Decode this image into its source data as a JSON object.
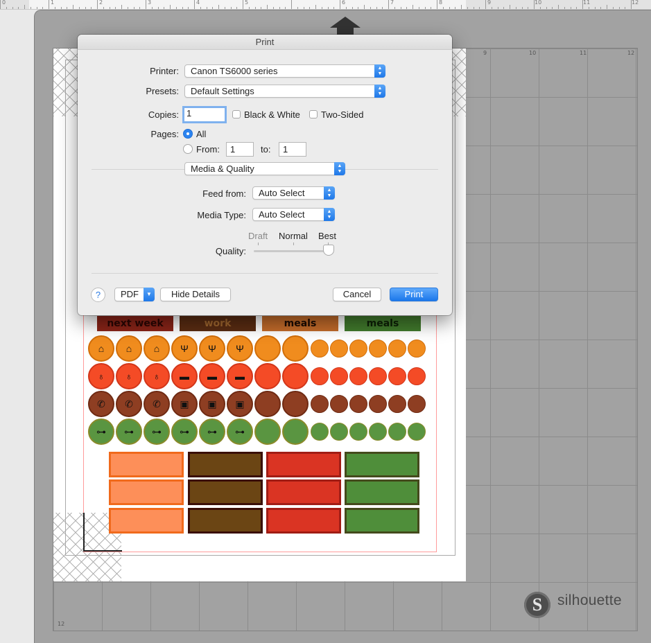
{
  "ruler": {
    "numbers": [
      "0",
      "1",
      "2",
      "3",
      "4",
      "5",
      "6",
      "7",
      "8",
      "9",
      "10",
      "11",
      "12"
    ]
  },
  "mat": {
    "grid_numbers": [
      "9",
      "10",
      "11",
      "12"
    ],
    "bottom_number": "12"
  },
  "stickers": {
    "labels": [
      "next week",
      "work",
      "meals",
      "meals"
    ],
    "colors": {
      "orange": "#f08c1e",
      "red": "#f44b26",
      "brown": "#8e3e22",
      "green": "#5a9541",
      "dark_red": "#8a2418",
      "dark_brown": "#5a2c12",
      "rect_orange": "#fd8f59",
      "rect_brown": "#6b4514",
      "rect_red": "#da3423",
      "rect_green": "#4f8e3a"
    },
    "icon_names": [
      "house-icon",
      "utensils-icon",
      "stethoscope-icon",
      "car-icon",
      "phone-icon",
      "gift-icon",
      "dumbbell-icon"
    ]
  },
  "logo": {
    "text": "silhouette",
    "mark": "S"
  },
  "dialog": {
    "title": "Print",
    "printer": {
      "label": "Printer:",
      "value": "Canon TS6000 series"
    },
    "presets": {
      "label": "Presets:",
      "value": "Default Settings"
    },
    "copies": {
      "label": "Copies:",
      "value": "1"
    },
    "black_white": "Black & White",
    "two_sided": "Two-Sided",
    "pages": {
      "label": "Pages:",
      "all": "All",
      "from_label": "From:",
      "from_value": "1",
      "to_label": "to:",
      "to_value": "1"
    },
    "section": "Media & Quality",
    "feed_from": {
      "label": "Feed from:",
      "value": "Auto Select"
    },
    "media_type": {
      "label": "Media Type:",
      "value": "Auto Select"
    },
    "quality": {
      "label": "Quality:",
      "draft": "Draft",
      "normal": "Normal",
      "best": "Best",
      "level": 1.0
    },
    "buttons": {
      "help": "?",
      "pdf": "PDF",
      "hide_details": "Hide Details",
      "cancel": "Cancel",
      "print": "Print"
    }
  }
}
